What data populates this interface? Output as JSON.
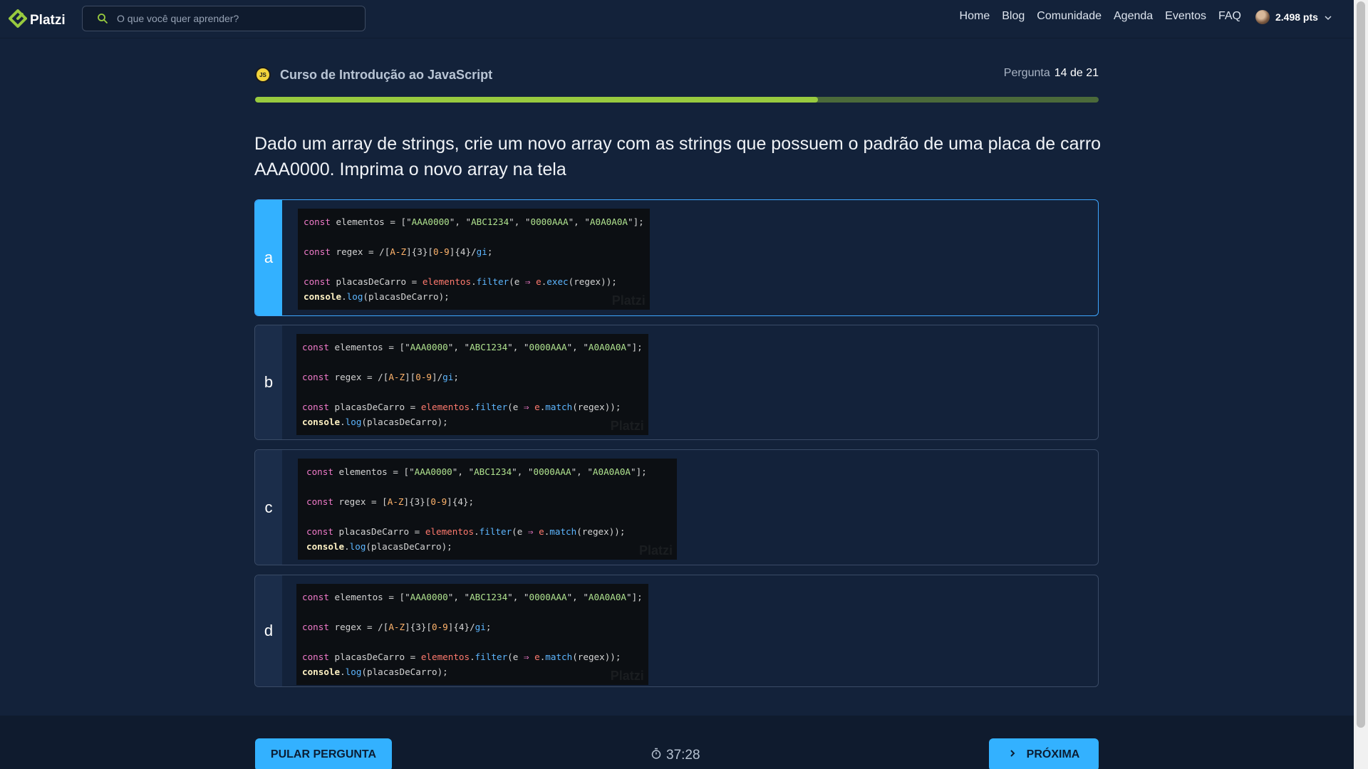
{
  "header": {
    "logo_text": "Platzi",
    "search_placeholder": "O que você quer aprender?",
    "nav": [
      "Home",
      "Blog",
      "Comunidade",
      "Agenda",
      "Eventos",
      "FAQ"
    ],
    "points": "2.498 pts"
  },
  "course": {
    "badge": "JS",
    "title": "Curso de Introdução ao JavaScript",
    "question_label": "Pergunta",
    "question_number": "14 de 21",
    "progress": 0.667
  },
  "question": {
    "text": "Dado um array de strings, crie um novo array com as strings que possuem o padrão de uma placa de carro AAA0000. Imprima o novo array na tela"
  },
  "options": [
    {
      "letter": "a",
      "selected": true,
      "lines": [
        "const elementos = [\"AAA0000\", \"ABC1234\", \"0000AAA\", \"A0A0A0A\"];",
        "",
        "const regex = /[A-Z]{3}[0-9]{4}/gi;",
        "",
        "const placasDeCarro = elementos.filter(e ⇒ e.exec(regex));",
        "console.log(placasDeCarro);"
      ]
    },
    {
      "letter": "b",
      "selected": false,
      "lines": [
        "const elementos = [\"AAA0000\", \"ABC1234\", \"0000AAA\", \"A0A0A0A\"];",
        "",
        "const regex = /[A-Z][0-9]/gi;",
        "",
        "const placasDeCarro = elementos.filter(e ⇒ e.match(regex));",
        "console.log(placasDeCarro);"
      ]
    },
    {
      "letter": "c",
      "selected": false,
      "lines": [
        "const elementos = [\"AAA0000\", \"ABC1234\", \"0000AAA\", \"A0A0A0A\"];",
        "",
        "const regex = [A-Z]{3}[0-9]{4};",
        "",
        "const placasDeCarro = elementos.filter(e ⇒ e.match(regex));",
        "console.log(placasDeCarro);"
      ]
    },
    {
      "letter": "d",
      "selected": false,
      "lines": [
        "const elementos = [\"AAA0000\", \"ABC1234\", \"0000AAA\", \"A0A0A0A\"];",
        "",
        "const regex = /[A-Z]{3}[0-9]{4}/gi;",
        "",
        "const placasDeCarro = elementos.filter(e ⇒ e.match(regex));",
        "console.log(placasDeCarro);"
      ]
    }
  ],
  "code_watermark": "Platzi",
  "footer": {
    "skip_label": "PULAR PERGUNTA",
    "timer": "37:28",
    "next_label": "PRÓXIMA"
  },
  "colors": {
    "background": "#13223a",
    "accent": "#33b1ff",
    "progress_fill": "#98ca3f",
    "progress_track": "#4b6a3a",
    "brand": "#98ca3f"
  },
  "icons": {
    "logo": "platzi-logo-icon",
    "search": "search-icon",
    "user_menu": "chevron-down-icon",
    "timer": "stopwatch-icon",
    "next": "chevron-right-icon"
  }
}
